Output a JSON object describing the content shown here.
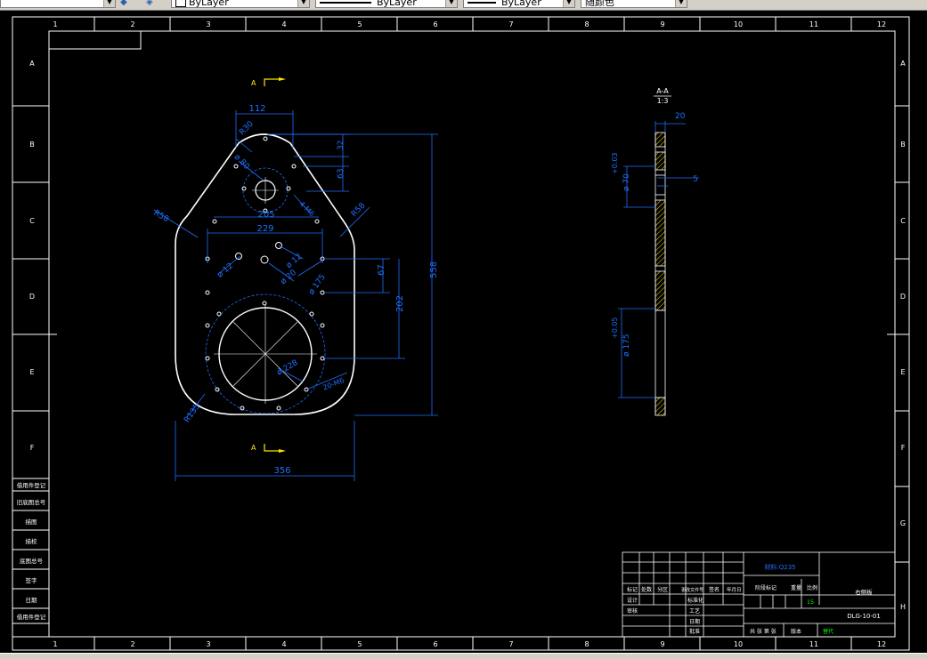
{
  "toolbar": {
    "layer_value": "ByLayer",
    "linetype_value": "ByLayer",
    "lineweight_value": "ByLayer",
    "plotstyle_value": "随颜色"
  },
  "frame": {
    "col_numbers": [
      "1",
      "2",
      "3",
      "4",
      "5",
      "6",
      "7",
      "8",
      "9",
      "10",
      "11",
      "12"
    ],
    "row_letters": [
      "A",
      "B",
      "C",
      "D",
      "E",
      "F",
      "G",
      "H"
    ]
  },
  "front_view": {
    "section_mark": "A",
    "dimensions": {
      "top_width": "112",
      "r30": "R30",
      "d80": "ø 80",
      "dim_32": "32",
      "dim_63": "63",
      "m6_top": "4-M6",
      "r58_left": "R58",
      "r58_right": "R58",
      "dim_205": "205",
      "dim_229": "229",
      "d12_left": "ø 12",
      "d12_right": "ø 12",
      "d20": "ø 20",
      "d175": "ø 175",
      "dim_67": "67",
      "dim_202": "202",
      "dim_558": "558",
      "d228": "ø 228",
      "m6_bottom": "20-M6",
      "r135": "R135",
      "dim_356": "356"
    }
  },
  "section_view": {
    "title": "A-A",
    "scale": "1:3",
    "thickness": "20",
    "tol_top": "+0.03",
    "d70": "ø 70",
    "dim_5": "5",
    "tol_bottom": "+0.05",
    "d175": "ø 175"
  },
  "side_table": {
    "rows": [
      "借用件登记",
      "旧底图总号",
      "描图",
      "描校",
      "底图总号",
      "签字",
      "日期"
    ],
    "top_label": "借用件登记"
  },
  "title_block": {
    "material": "材料:Q235",
    "part_name": "右侧板",
    "drawing_no": "DLG-10-01",
    "scale_value": "15",
    "header_labels": [
      "标记",
      "处数",
      "分区",
      "更改文件号",
      "签名",
      "年月日"
    ],
    "row_labels": [
      "设计",
      "审核",
      "工艺",
      "批准"
    ],
    "sub_labels": [
      "标准化",
      "日期"
    ],
    "stage_label": "阶段标记",
    "weight_label": "重量",
    "ratio_label": "比例",
    "footer": "共 张 第 张",
    "version_label": "版本",
    "version_value": "替代"
  },
  "colors": {
    "background": "#000000",
    "outline": "#ffffff",
    "dimension": "#1e6fff",
    "marker": "#ffe600",
    "hatch": "#ffe600",
    "green_text": "#00ff00"
  }
}
